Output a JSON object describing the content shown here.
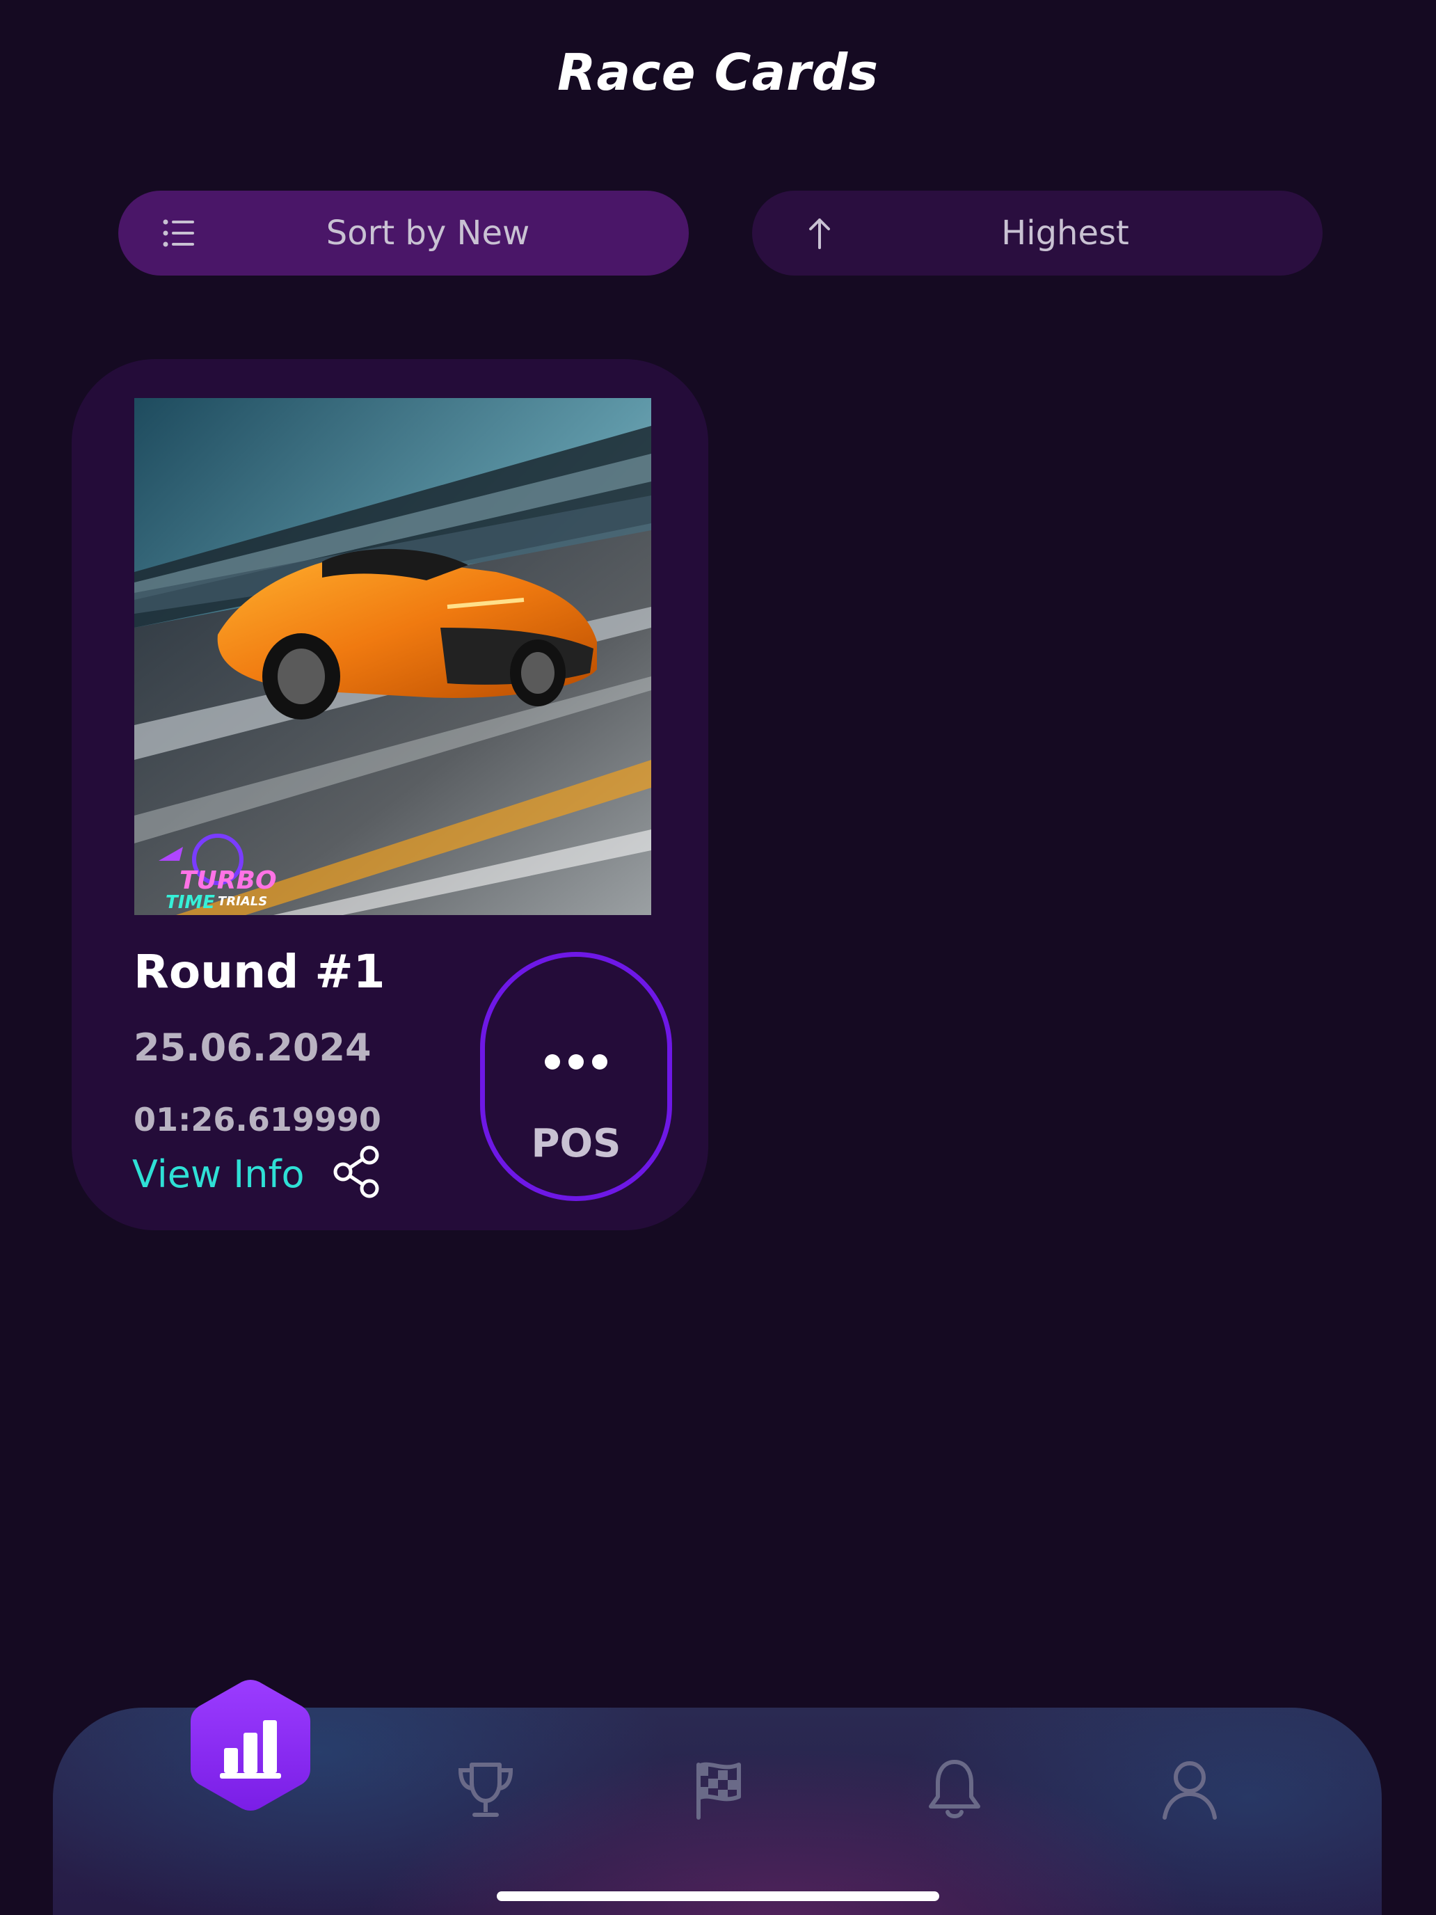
{
  "header": {
    "title": "Race Cards"
  },
  "controls": {
    "sort_label": "Sort by New",
    "sort_icon": "list-icon",
    "order_label": "Highest",
    "order_icon": "arrow-up-icon"
  },
  "cards": [
    {
      "image_alt": "Orange sports car racing on a track",
      "image_logo_text": "TURBO TIME TRIALS",
      "title": "Round #1",
      "date": "25.06.2024",
      "time": "01:26.619990",
      "view_info_label": "View Info",
      "share_icon": "share-icon",
      "pos_label": "POS",
      "pos_value_icon": "ellipsis-icon"
    }
  ],
  "bottom_nav": {
    "items": [
      {
        "icon": "bar-chart-icon",
        "active": true
      },
      {
        "icon": "trophy-icon",
        "active": false
      },
      {
        "icon": "checkered-flag-icon",
        "active": false
      },
      {
        "icon": "bell-icon",
        "active": false
      },
      {
        "icon": "user-icon",
        "active": false
      }
    ]
  },
  "colors": {
    "background": "#150a22",
    "accent_purple": "#6e18e6",
    "view_info": "#2fe0d6",
    "card_bg": "#240c39"
  }
}
